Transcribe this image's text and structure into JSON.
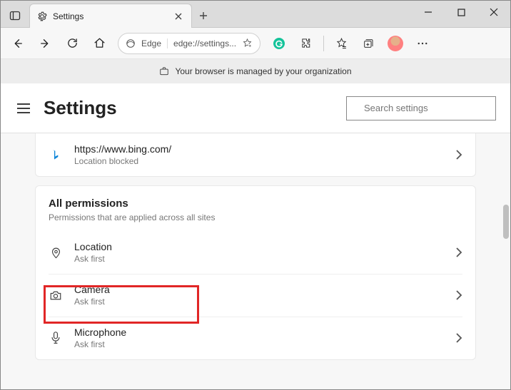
{
  "tab": {
    "title": "Settings"
  },
  "omnibox": {
    "brand": "Edge",
    "url": "edge://settings..."
  },
  "infobar": {
    "text": "Your browser is managed by your organization"
  },
  "header": {
    "title": "Settings",
    "search_placeholder": "Search settings"
  },
  "recent": {
    "site": "https://www.bing.com/",
    "status": "Location blocked"
  },
  "section": {
    "title": "All permissions",
    "subtitle": "Permissions that are applied across all sites"
  },
  "perms": [
    {
      "label": "Location",
      "sub": "Ask first"
    },
    {
      "label": "Camera",
      "sub": "Ask first"
    },
    {
      "label": "Microphone",
      "sub": "Ask first"
    }
  ]
}
